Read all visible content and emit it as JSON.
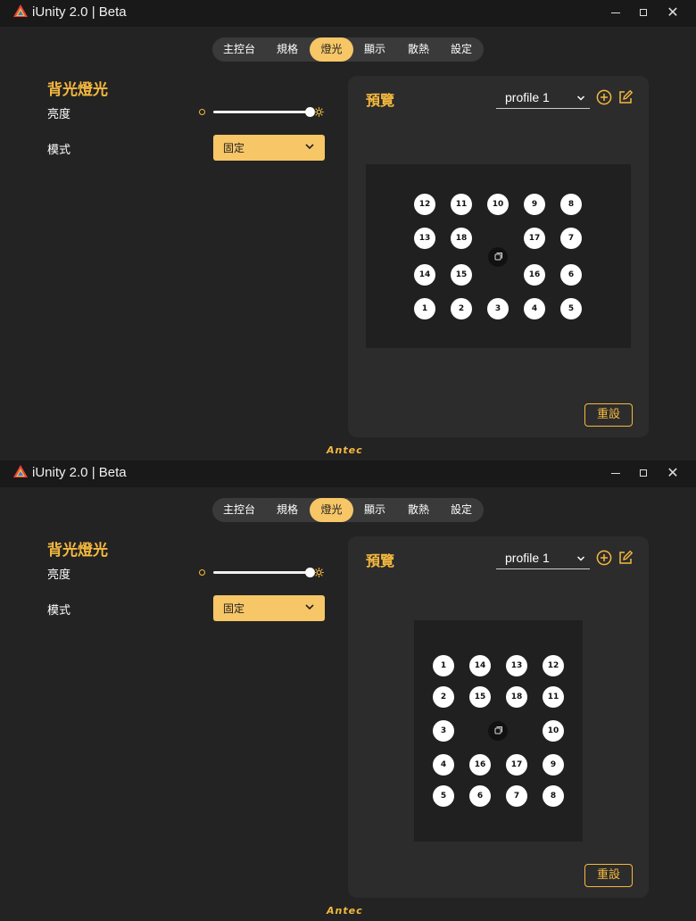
{
  "app": {
    "title": "iUnity 2.0 | Beta"
  },
  "window_controls": {
    "close": "✕"
  },
  "tabs": [
    {
      "label": "主控台",
      "active": false
    },
    {
      "label": "規格",
      "active": false
    },
    {
      "label": "燈光",
      "active": true
    },
    {
      "label": "顯示",
      "active": false
    },
    {
      "label": "散熱",
      "active": false
    },
    {
      "label": "設定",
      "active": false
    }
  ],
  "backlight": {
    "title": "背光燈光",
    "brightness_label": "亮度",
    "brightness_value": 1.0,
    "mode_label": "模式",
    "mode_value": "固定"
  },
  "preview": {
    "title": "預覽",
    "profile": "profile 1",
    "reset_label": "重設"
  },
  "layouts": [
    {
      "orientation": "horizontal",
      "rows": [
        [
          "12",
          "11",
          "10",
          "9",
          "8"
        ],
        [
          "13",
          "18",
          "",
          "17",
          "7"
        ],
        [
          "14",
          "15",
          "",
          "16",
          "6"
        ],
        [
          "1",
          "2",
          "3",
          "4",
          "5"
        ]
      ]
    },
    {
      "orientation": "vertical",
      "rows": [
        [
          "1",
          "14",
          "13",
          "12"
        ],
        [
          "2",
          "15",
          "18",
          "11"
        ],
        [
          "3",
          "",
          "",
          "10"
        ],
        [
          "4",
          "16",
          "17",
          "9"
        ],
        [
          "5",
          "6",
          "7",
          "8"
        ]
      ]
    }
  ],
  "brand": "Antec",
  "colors": {
    "accent": "#f5b93f",
    "tab_active": "#f6c667",
    "background": "#232323",
    "panel": "#2c2c2c",
    "titlebar": "#191919"
  }
}
